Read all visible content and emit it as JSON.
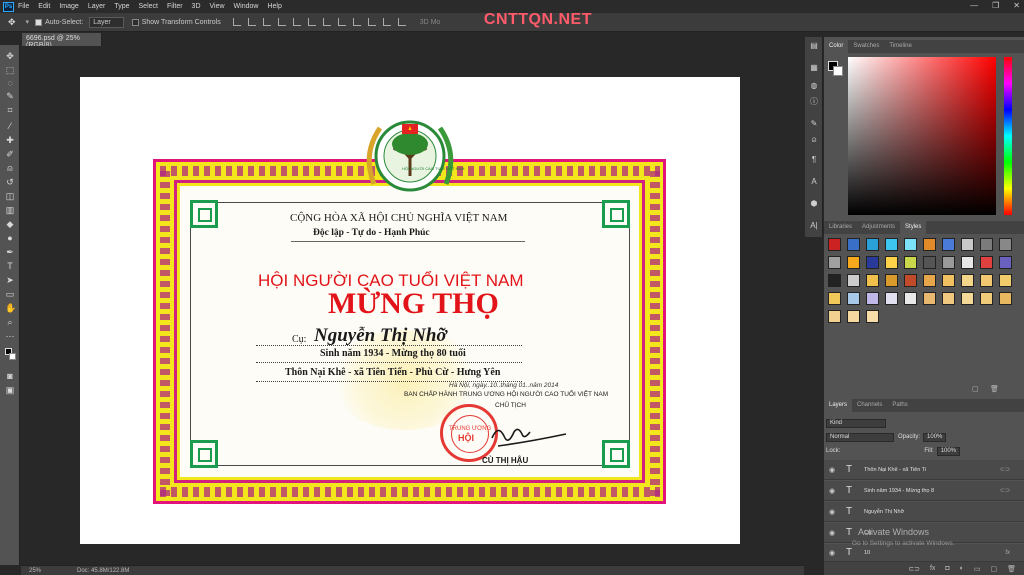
{
  "menu": {
    "logo": "Ps",
    "items": [
      "File",
      "Edit",
      "Image",
      "Layer",
      "Type",
      "Select",
      "Filter",
      "3D",
      "View",
      "Window",
      "Help"
    ],
    "window_controls": [
      "—",
      "❐",
      "✕"
    ]
  },
  "options_bar": {
    "auto_select_label": "Auto-Select:",
    "auto_select_value": "Layer",
    "transform_label": "Show Transform Controls",
    "mode_3d": "3D Mo"
  },
  "watermark": "CNTTQN.NET",
  "document": {
    "tab_title": "6696.psd @ 25% (RGB/8)",
    "zoom": "25%",
    "doc_size": "Doc: 45.8M/122.8M"
  },
  "certificate": {
    "emblem_ring_text": "HỘI NGƯỜI CAO TUỔI VIỆT NAM",
    "nation": "CỘNG HÒA XÃ HỘI CHỦ NGHĨA VIỆT NAM",
    "motto": "Độc lập - Tự do - Hạnh Phúc",
    "association": "HỘI NGƯỜI CAO TUỔI VIỆT NAM",
    "congrats": "MỪNG THỌ",
    "honorific": "Cụ:",
    "name": "Nguyễn Thị Nhỡ",
    "birth": "Sinh năm 1934  - Mừng thọ 80 tuổi",
    "address": "Thôn Nại Khê - xã Tiên Tiến - Phù Cừ - Hưng Yên",
    "date": "Hà Nội, ngày..10..tháng 01..năm 2014",
    "board": "BAN CHẤP HÀNH TRUNG ƯƠNG HỘI NGƯỜI CAO TUỔI VIỆT NAM",
    "chair": "CHỦ TỊCH",
    "seal_top": "TRUNG ƯƠNG",
    "seal_name": "HỘI",
    "signer": "CÙ THỊ HẬU"
  },
  "panels": {
    "color_tabs": [
      "Color",
      "Swatches",
      "Timeline"
    ],
    "style_tabs": [
      "Libraries",
      "Adjustments",
      "Styles"
    ],
    "layer_tabs": [
      "Layers",
      "Channels",
      "Paths"
    ],
    "filter_kind": "Kind",
    "blend_mode": "Normal",
    "opacity_label": "Opacity:",
    "opacity_value": "100%",
    "lock_label": "Lock:",
    "fill_label": "Fill:",
    "fill_value": "100%"
  },
  "layers": [
    {
      "name": "Thôn Nại Khê - xã Tiên Ti"
    },
    {
      "name": "Sinh năm 1934  - Mừng thọ 8"
    },
    {
      "name": "Nguyễn Thị Nhỡ"
    },
    {
      "name": "Cụ:"
    },
    {
      "name": "10"
    }
  ],
  "activate": {
    "title": "Activate Windows",
    "subtitle": "Go to Settings to activate Windows."
  },
  "colors": {
    "fg": "#000000",
    "bg": "#ffffff",
    "border_magenta": "#e2147b",
    "border_yellow": "#f4e61c",
    "greek_green": "#1a9c4f",
    "title_red": "#e2141a"
  },
  "style_swatches": [
    "#c22",
    "#3a6fc8",
    "#2aa0d8",
    "#3dc7f0",
    "#7be0f8",
    "#e08a2a",
    "#4a7bd8",
    "#c8c8c8",
    "#7b7b7b",
    "#888",
    "#a0a0a0",
    "#f6a91c",
    "#2a3a9a",
    "#ffd24a",
    "#c8d84a",
    "#555",
    "#999",
    "#e8e8e8",
    "#e04040",
    "#6a60c0",
    "#222",
    "#ccc",
    "#f0c14a",
    "#d89a2a",
    "#c04a2a",
    "#e8a64a",
    "#f0c060",
    "#f4d68a",
    "#f2c870",
    "#f2cc6a",
    "#f0c85a",
    "#a8c8e8",
    "#c0b8e8",
    "#e0e0f0",
    "#e8e8e8",
    "#e8b870",
    "#f0c880",
    "#f4d898",
    "#f0cc7a",
    "#e8b860",
    "#f2d090",
    "#f4d8a0",
    "#f6dca8"
  ]
}
